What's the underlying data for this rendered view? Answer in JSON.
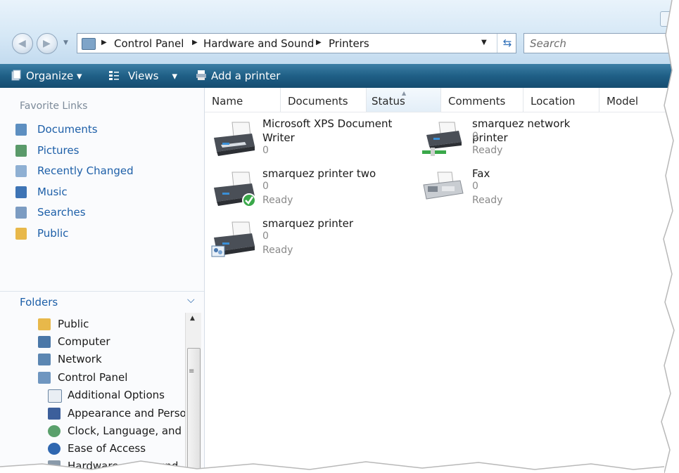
{
  "address_bar": {
    "crumbs": [
      "Control Panel",
      "Hardware and Sound",
      "Printers"
    ],
    "search_placeholder": "Search"
  },
  "toolbar": {
    "organize": "Organize",
    "views": "Views",
    "add_printer": "Add a printer"
  },
  "sidebar": {
    "favorites_title": "Favorite Links",
    "favorites": [
      {
        "label": "Documents",
        "icon": "documents-icon"
      },
      {
        "label": "Pictures",
        "icon": "pictures-icon"
      },
      {
        "label": "Recently Changed",
        "icon": "recently-changed-icon"
      },
      {
        "label": "Music",
        "icon": "music-icon"
      },
      {
        "label": "Searches",
        "icon": "searches-icon"
      },
      {
        "label": "Public",
        "icon": "folder-icon"
      }
    ],
    "folders_title": "Folders",
    "tree": [
      {
        "label": "Public",
        "icon": "folder-icon"
      },
      {
        "label": "Computer",
        "icon": "computer-icon"
      },
      {
        "label": "Network",
        "icon": "network-icon"
      },
      {
        "label": "Control Panel",
        "icon": "control-panel-icon"
      },
      {
        "label": "Additional Options",
        "icon": "additional-options-icon"
      },
      {
        "label": "Appearance and Person",
        "icon": "appearance-icon"
      },
      {
        "label": "Clock, Language, and R",
        "icon": "clock-language-icon"
      },
      {
        "label": "Ease of Access",
        "icon": "ease-of-access-icon"
      },
      {
        "label": "Hardware and Sound",
        "icon": "hardware-sound-icon"
      }
    ]
  },
  "columns": [
    "Name",
    "Documents",
    "Status",
    "Comments",
    "Location",
    "Model"
  ],
  "printers": [
    {
      "name": "Microsoft XPS Document Writer",
      "documents": "0",
      "status": "",
      "icon": "printer-icon"
    },
    {
      "name": "smarquez network printer",
      "documents": "0",
      "status": "Ready",
      "icon": "network-printer-icon"
    },
    {
      "name": "smarquez printer two",
      "documents": "0",
      "status": "Ready",
      "icon": "default-printer-icon"
    },
    {
      "name": "Fax",
      "documents": "0",
      "status": "Ready",
      "icon": "fax-icon"
    },
    {
      "name": "smarquez printer",
      "documents": "0",
      "status": "Ready",
      "icon": "shared-printer-icon"
    }
  ],
  "colors": {
    "toolbar": "#1f5f86",
    "link_blue": "#1d5fa8",
    "address_band": "#d6e8f6"
  }
}
